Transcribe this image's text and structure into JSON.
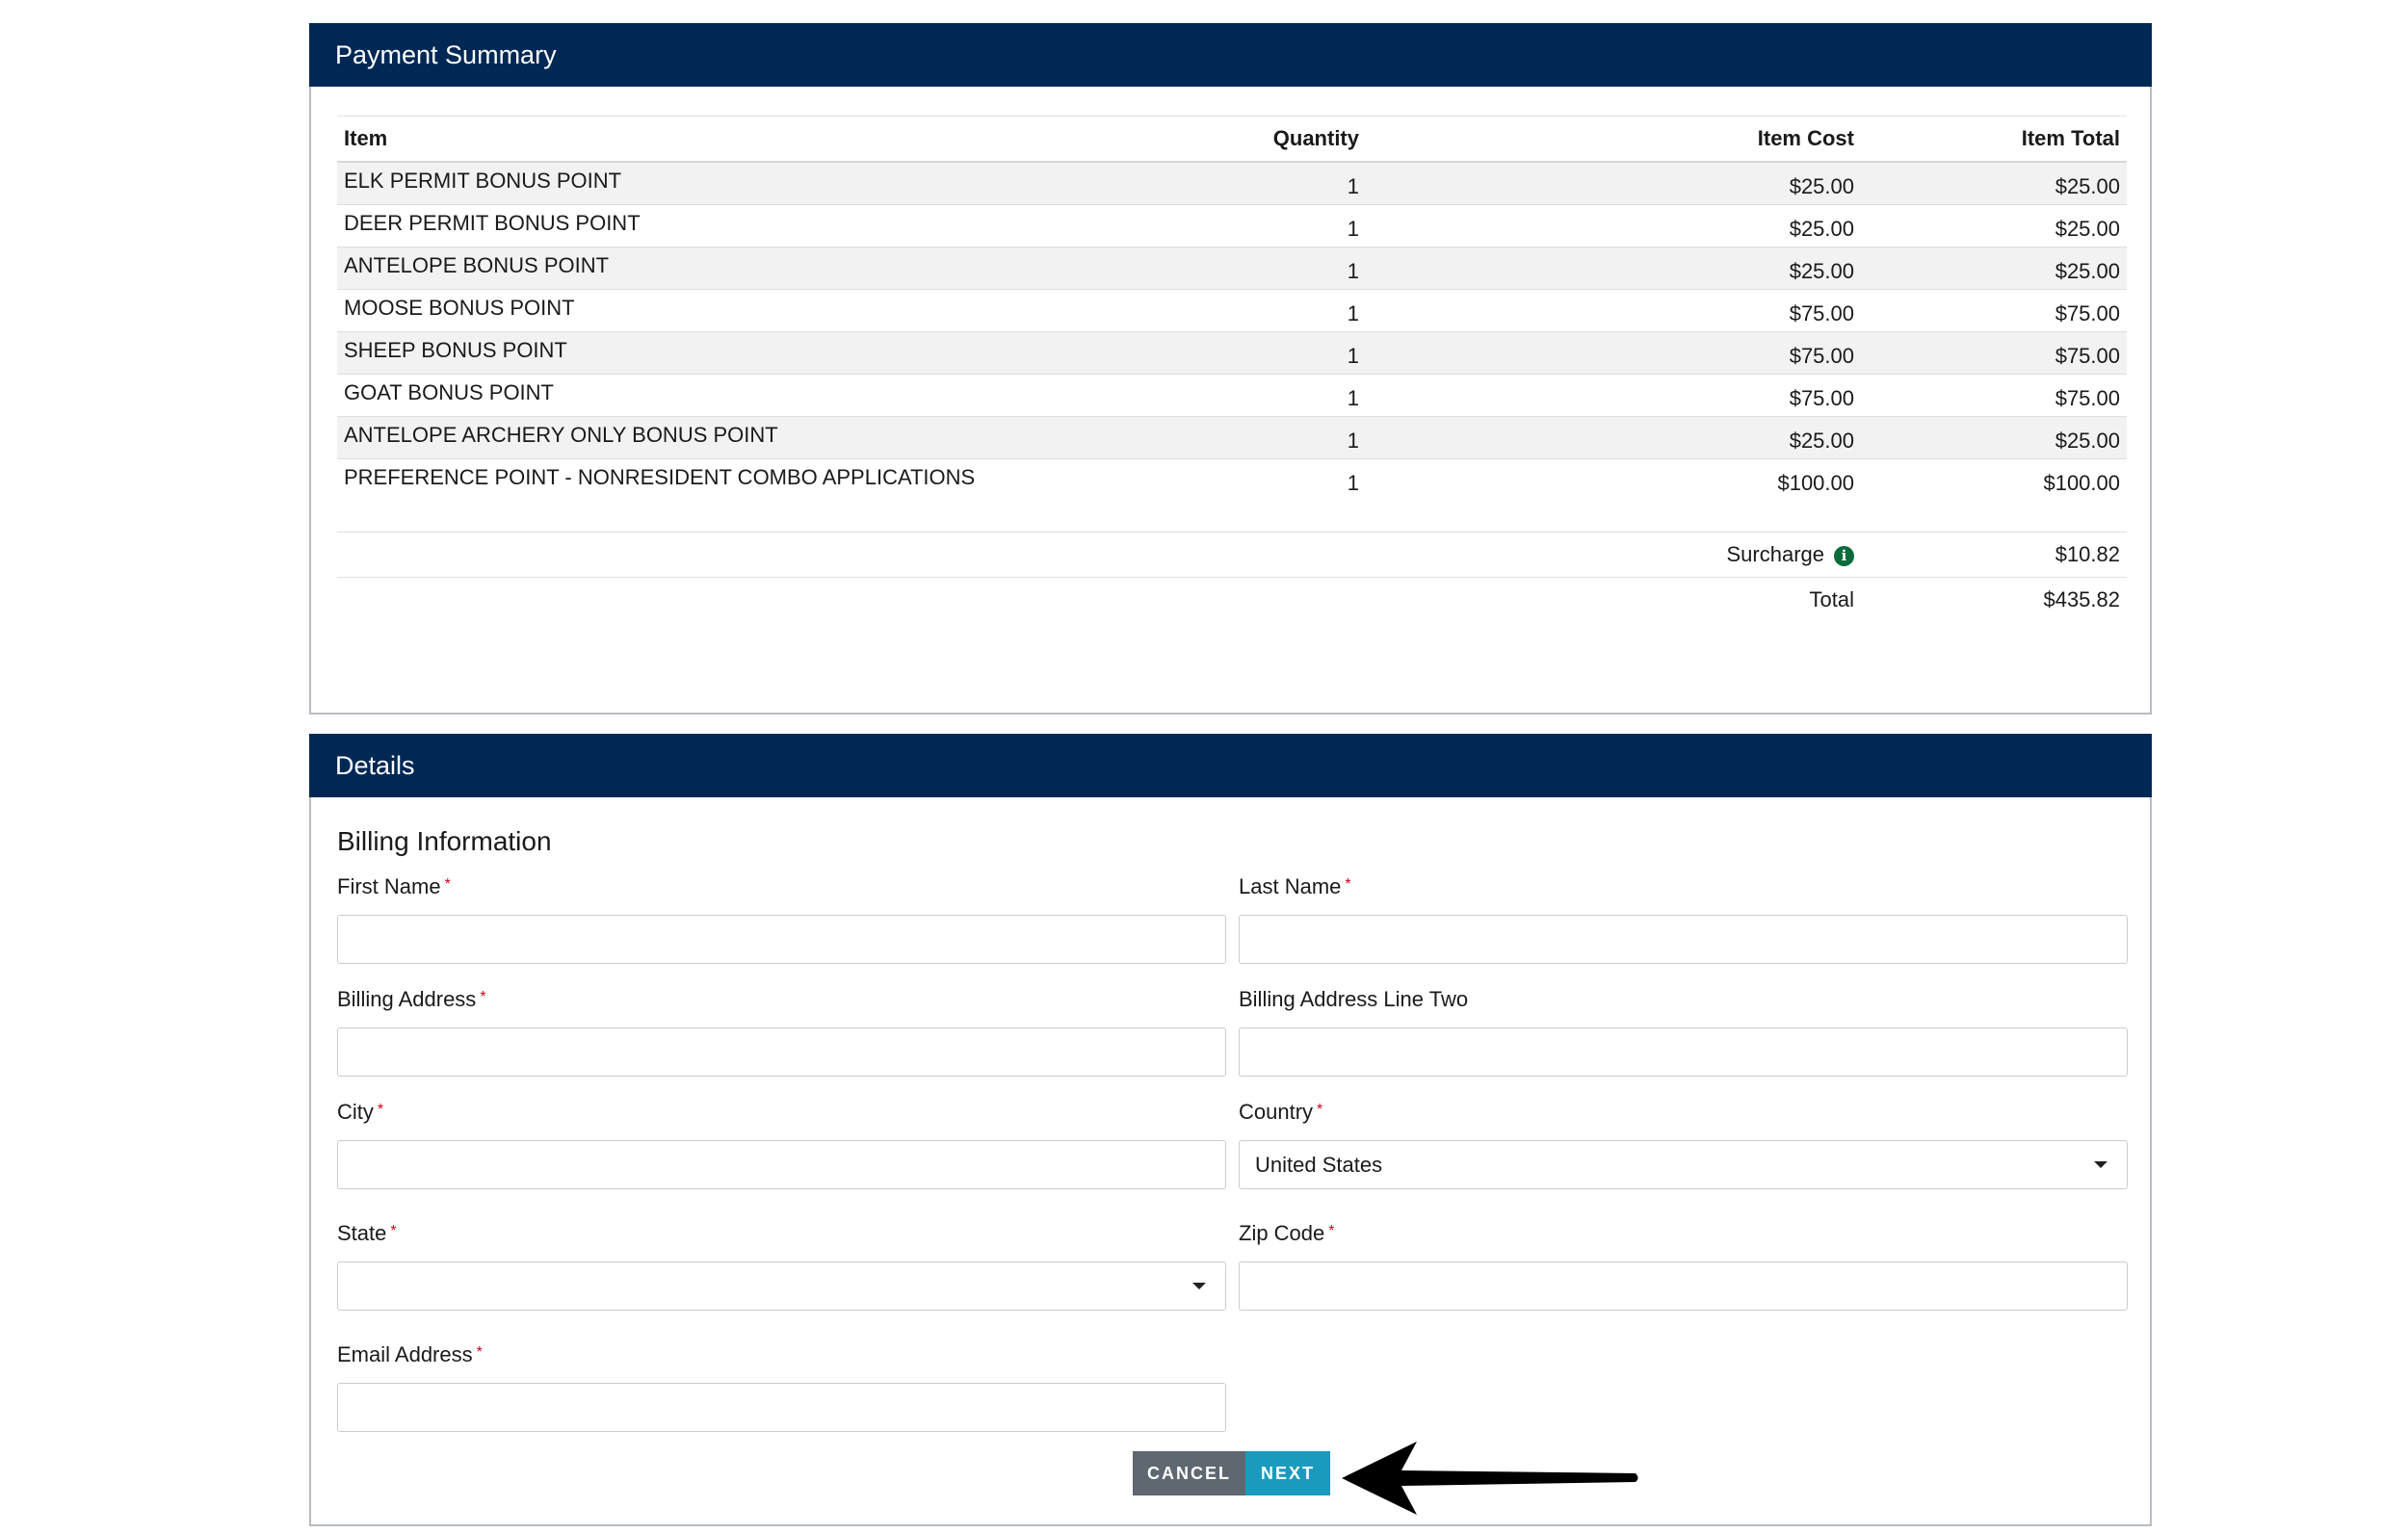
{
  "payment_summary": {
    "title": "Payment Summary",
    "columns": [
      "Item",
      "Quantity",
      "Item Cost",
      "Item Total"
    ],
    "rows": [
      {
        "item": "ELK PERMIT BONUS POINT",
        "quantity": "1",
        "cost": "$25.00",
        "total": "$25.00"
      },
      {
        "item": "DEER PERMIT BONUS POINT",
        "quantity": "1",
        "cost": "$25.00",
        "total": "$25.00"
      },
      {
        "item": "ANTELOPE BONUS POINT",
        "quantity": "1",
        "cost": "$25.00",
        "total": "$25.00"
      },
      {
        "item": "MOOSE BONUS POINT",
        "quantity": "1",
        "cost": "$75.00",
        "total": "$75.00"
      },
      {
        "item": "SHEEP BONUS POINT",
        "quantity": "1",
        "cost": "$75.00",
        "total": "$75.00"
      },
      {
        "item": "GOAT BONUS POINT",
        "quantity": "1",
        "cost": "$75.00",
        "total": "$75.00"
      },
      {
        "item": "ANTELOPE ARCHERY ONLY BONUS POINT",
        "quantity": "1",
        "cost": "$25.00",
        "total": "$25.00"
      },
      {
        "item": "PREFERENCE POINT - NONRESIDENT COMBO APPLICATIONS",
        "quantity": "1",
        "cost": "$100.00",
        "total": "$100.00"
      }
    ],
    "surcharge_label": "Surcharge",
    "surcharge_value": "$10.82",
    "total_label": "Total",
    "total_value": "$435.82",
    "info_icon": "i"
  },
  "details": {
    "title": "Details",
    "section_title": "Billing Information",
    "required_mark": "*",
    "fields": {
      "first_name": {
        "label": "First Name",
        "value": ""
      },
      "last_name": {
        "label": "Last Name",
        "value": ""
      },
      "billing_address": {
        "label": "Billing Address",
        "value": ""
      },
      "billing_address_two": {
        "label": "Billing Address Line Two",
        "value": ""
      },
      "city": {
        "label": "City",
        "value": ""
      },
      "country": {
        "label": "Country",
        "value": "United States"
      },
      "state": {
        "label": "State",
        "value": ""
      },
      "zip": {
        "label": "Zip Code",
        "value": ""
      },
      "email": {
        "label": "Email Address",
        "value": ""
      }
    },
    "buttons": {
      "cancel": "CANCEL",
      "next": "NEXT"
    }
  },
  "colors": {
    "header_bg": "#002855",
    "cancel_bg": "#5f6770",
    "next_bg": "#1a9bbd",
    "required": "#d0021b",
    "info_icon": "#0b6b3a"
  }
}
